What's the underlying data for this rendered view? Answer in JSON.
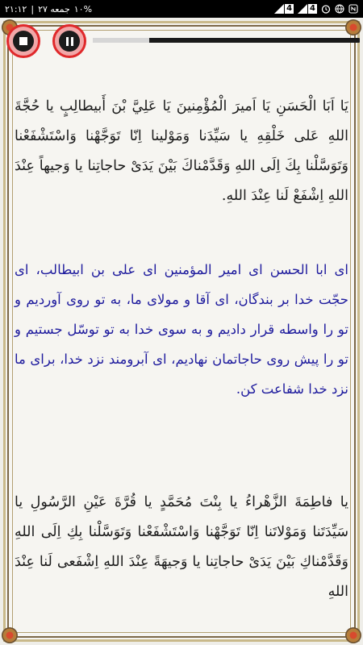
{
  "status_bar": {
    "time": "۲۱:۱۲",
    "date": "جمعه ۲۷",
    "battery": "۱۰%",
    "sim1": "4",
    "sim2": "4"
  },
  "player": {
    "progress_fraction": 0.21
  },
  "blocks": [
    {
      "lang": "arabic",
      "text": "يَا اَبَا الْحَسَنِ يَا اَميرَ الْمُؤْمِنينَ يَا عَلِيَّ بْنَ أَبيطالِبٍ يا حُجَّةَ اللهِ عَلى خَلْقِهِ يا سَيِّدَنا وَمَوْلينا اِنّا تَوَجَّهْنا وَاسْتَشْفَعْنا وَتَوَسَّلْنا بِكَ اِلَى اللهِ وَقَدَّمْناكَ بَيْنَ يَدَىْ حاجاتِنا يا وَجيهاً عِنْدَ اللهِ اِشْفَعْ لَنا عِنْدَ اللهِ."
    },
    {
      "lang": "persian",
      "text": "اى ابا الحسن اى امير المؤمنين اى على بن ابيطالب، اى حجّت خدا بر بندگان، اى آقا و مولاى ما، به تو روى آورديم و تو را واسطه قرار داديم و به سوى خدا به تو توسّل جستيم و تو را پيش روى حاجاتمان نهاديم، اى آبرومند نزد خدا، براى ما نزد خدا شفاعت كن."
    },
    {
      "lang": "arabic",
      "text": "يا فاطِمَةَ الزَّهْراءُ يا بِنْتَ مُحَمَّدٍ يا قُرَّةَ عَيْنِ الرَّسُولِ يا سَيِّدَتَنا وَمَوْلاتَنا اِنّا تَوَجَّهْنا وَاسْتَشْفَعْنا وَتَوَسَّلْنا بِكِ اِلَى اللهِ وَقَدَّمْناكِ بَيْنَ يَدَىْ حاجاتِنا يا وَجيهَةً عِنْدَ اللهِ اِشْفَعى لَنا عِنْدَ اللهِ"
    }
  ]
}
